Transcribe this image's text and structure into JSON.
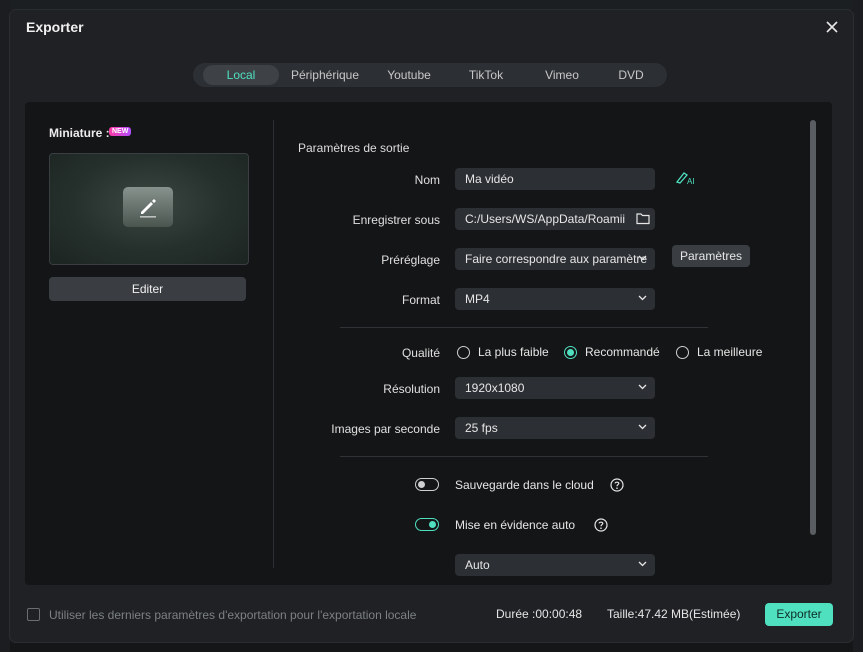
{
  "dialog": {
    "title": "Exporter"
  },
  "tabs": [
    {
      "label": "Local",
      "active": true
    },
    {
      "label": "Périphérique",
      "active": false
    },
    {
      "label": "Youtube",
      "active": false
    },
    {
      "label": "TikTok",
      "active": false
    },
    {
      "label": "Vimeo",
      "active": false
    },
    {
      "label": "DVD",
      "active": false
    }
  ],
  "thumbnail": {
    "label": "Miniature :",
    "badge": "NEW",
    "edit_label": "Editer"
  },
  "output": {
    "section_title": "Paramètres de sortie",
    "name": {
      "label": "Nom",
      "value": "Ma vidéo"
    },
    "save_to": {
      "label": "Enregistrer sous",
      "value": "C:/Users/WS/AppData/Roamii"
    },
    "preset": {
      "label": "Préréglage",
      "value": "Faire correspondre aux paramètre",
      "button": "Paramètres"
    },
    "format": {
      "label": "Format",
      "value": "MP4"
    },
    "quality": {
      "label": "Qualité",
      "options": [
        {
          "label": "La plus faible",
          "checked": false
        },
        {
          "label": "Recommandé",
          "checked": true
        },
        {
          "label": "La meilleure",
          "checked": false
        }
      ]
    },
    "resolution": {
      "label": "Résolution",
      "value": "1920x1080"
    },
    "fps": {
      "label": "Images par seconde",
      "value": "25 fps"
    },
    "cloud": {
      "label": "Sauvegarde dans le cloud",
      "on": false
    },
    "highlight": {
      "label": "Mise en évidence auto",
      "on": true
    },
    "highlight_mode": {
      "value": "Auto"
    }
  },
  "footer": {
    "checkbox_label": "Utiliser les derniers paramètres d'exportation pour l'exportation locale",
    "duration": "Durée :00:00:48",
    "size": "Taille:47.42 MB(Estimée)",
    "export_label": "Exporter"
  },
  "colors": {
    "accent": "#4fe0c0",
    "dialog_bg": "#1f2124",
    "panel_bg": "#141516",
    "field_bg": "#2c2f33"
  }
}
